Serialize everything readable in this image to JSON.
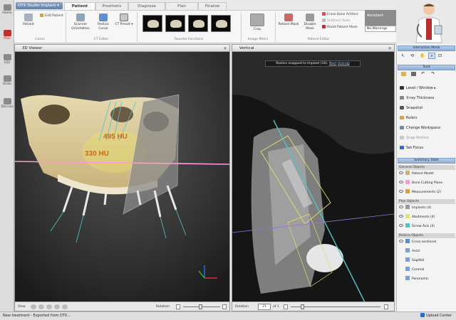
{
  "sidebar": {
    "items": [
      {
        "label": "Home"
      },
      {
        "label": "Plan"
      },
      {
        "label": "Info"
      },
      {
        "label": "Order"
      },
      {
        "label": "Discuss"
      }
    ]
  },
  "app": {
    "menu_label": "DTX Studio Implant"
  },
  "tabs": [
    {
      "label": "Patient"
    },
    {
      "label": "Prosthetic"
    },
    {
      "label": "Diagnose"
    },
    {
      "label": "Plan"
    },
    {
      "label": "Finalize"
    }
  ],
  "ribbon": {
    "patient_label": "Patient",
    "edit_patient": "Edit Patient",
    "group_cases": "Cases",
    "scanner_orientation": "Scanner Orientation",
    "reslice_curve": "Reslice Curve",
    "ct_preset": "CT Preset",
    "group_ct_editor": "CT Editor",
    "group_favorite_functions": "Favorite Functions",
    "crop": "Crop",
    "group_image_filters": "Image filters",
    "patient_mask": "Patient Mask",
    "disable_mask": "Disable Mask",
    "erase_bone_artifact": "Erase Bone Artifact",
    "subtract_teeth": "Subtract Teeth",
    "reset_patient_mask": "Reset Patient Mask",
    "group_patient_editor": "Patient Editor"
  },
  "assistant": {
    "label": "Assistant",
    "warnings": "No Warnings"
  },
  "viewer3d": {
    "title": "3D Viewer",
    "hu_1": "495 HU",
    "hu_2": "330 HU",
    "view_label": "View",
    "rotation_label": "Rotation"
  },
  "sagittal": {
    "title": "Vertical",
    "notice": "Reslice snapped to Implant (10).",
    "next": "Next",
    "unsnap": "Unsnap",
    "rotation_label": "Rotation",
    "rotation_value": "21",
    "rotation_of": "of 1"
  },
  "panels": {
    "interaction_mode": "Interaction Mode",
    "tools": "Tools",
    "tools_items": [
      {
        "label": "Level / Window"
      },
      {
        "label": "X-ray Thickness"
      },
      {
        "label": "Snapshot"
      },
      {
        "label": "Rulers"
      },
      {
        "label": "Change Workspace"
      },
      {
        "label": "Snap Reslice"
      },
      {
        "label": "Set Focus"
      }
    ],
    "scene_tree": "Summary Table",
    "general_objects": "General Objects",
    "general_items": [
      {
        "label": "Patient Model"
      },
      {
        "label": "Bone Cutting Plane"
      },
      {
        "label": "Measurements (2)"
      }
    ],
    "plan_objects": "Plan Objects",
    "plan_items": [
      {
        "label": "Implants (4)"
      },
      {
        "label": "Abutments (4)"
      },
      {
        "label": "Screw Axis (4)"
      }
    ],
    "reslice_objects": "Reslice Objects",
    "reslice_items": [
      {
        "label": "Cross-sectional"
      },
      {
        "label": "Axial"
      },
      {
        "label": "Sagittal"
      },
      {
        "label": "Coronal"
      },
      {
        "label": "Panoramic"
      }
    ]
  },
  "status": {
    "left": "New treatment - Exported from DTX...",
    "right": "Upload Center"
  },
  "colors": {
    "accent_red": "#c03030",
    "ribbon_blue": "#8fb0d8",
    "guide_cyan": "#4ec6c6",
    "hu_text": "#c86a1a",
    "plane_pink": "#ff9bd0"
  }
}
